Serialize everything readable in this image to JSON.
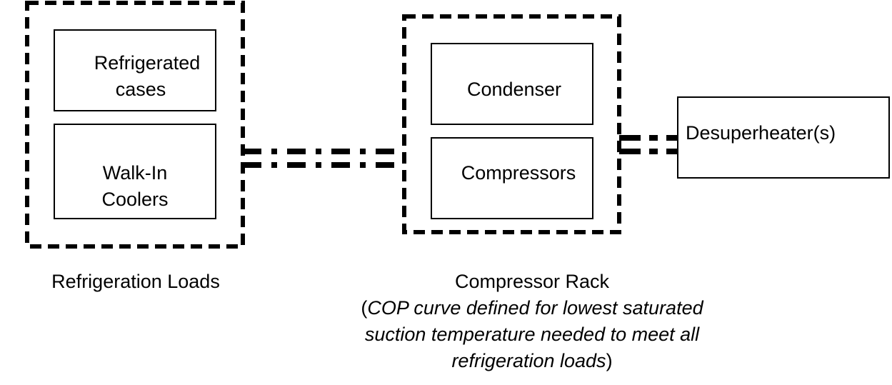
{
  "groups": {
    "refrigeration_loads": {
      "label": "Refrigeration Loads",
      "items": [
        {
          "line1": "Refrigerated",
          "line2": "cases"
        },
        {
          "line1": "Walk-In",
          "line2": "Coolers"
        }
      ]
    },
    "compressor_rack": {
      "label": "Compressor Rack",
      "note_open": "(",
      "note_line1": "COP curve defined for lowest saturated",
      "note_line2": "suction temperature needed to meet all",
      "note_line3": "refrigeration loads",
      "note_close": ")",
      "items": [
        {
          "label": "Condenser"
        },
        {
          "label": "Compressors"
        }
      ]
    },
    "desuperheater": {
      "label": "Desuperheater(s)"
    }
  }
}
